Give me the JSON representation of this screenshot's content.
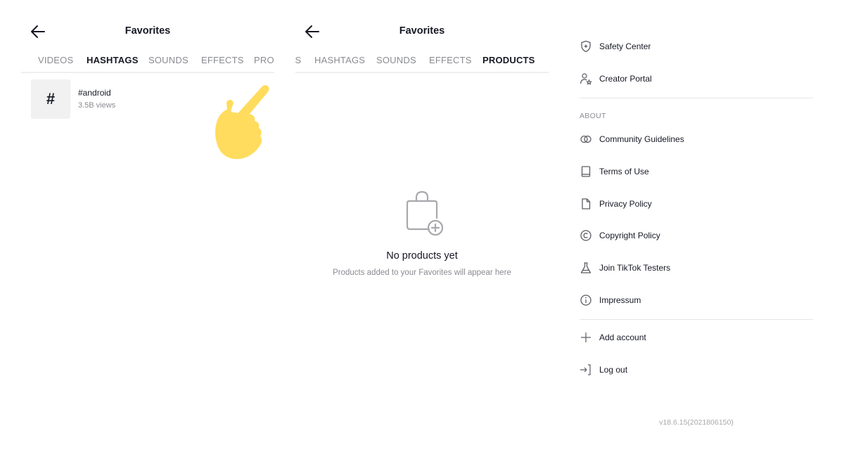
{
  "panel1": {
    "title": "Favorites",
    "tabs": [
      {
        "label": "VIDEOS",
        "active": false
      },
      {
        "label": "HASHTAGS",
        "active": true
      },
      {
        "label": "SOUNDS",
        "active": false
      },
      {
        "label": "EFFECTS",
        "active": false
      },
      {
        "label": "PRODUCTS",
        "active": false
      }
    ],
    "hashtags": [
      {
        "icon": "#",
        "name": "#android",
        "views": "3.5B views"
      }
    ]
  },
  "panel2": {
    "title": "Favorites",
    "tabs": [
      {
        "label": "VIDEOS",
        "active": false
      },
      {
        "label": "HASHTAGS",
        "active": false
      },
      {
        "label": "SOUNDS",
        "active": false
      },
      {
        "label": "EFFECTS",
        "active": false
      },
      {
        "label": "PRODUCTS",
        "active": true
      }
    ],
    "empty_state": {
      "title": "No products yet",
      "subtitle": "Products added to your Favorites will appear here"
    }
  },
  "panel3": {
    "top_items": [
      {
        "icon": "shield-plus-icon",
        "label": "Safety Center"
      },
      {
        "icon": "creator-user-icon",
        "label": "Creator Portal"
      }
    ],
    "about_label": "ABOUT",
    "about_items": [
      {
        "icon": "rings-icon",
        "label": "Community Guidelines"
      },
      {
        "icon": "book-icon",
        "label": "Terms of Use"
      },
      {
        "icon": "document-icon",
        "label": "Privacy Policy"
      },
      {
        "icon": "copyright-icon",
        "label": "Copyright Policy"
      },
      {
        "icon": "flask-icon",
        "label": "Join TikTok Testers"
      },
      {
        "icon": "info-icon",
        "label": "Impressum"
      }
    ],
    "account_items": [
      {
        "icon": "plus-icon",
        "label": "Add account"
      },
      {
        "icon": "logout-icon",
        "label": "Log out"
      }
    ],
    "version": "v18.6.15(2021806150)"
  },
  "colors": {
    "text_primary": "#161823",
    "text_secondary": "#8a8b91",
    "hand_emoji": "#ffdc5d"
  }
}
